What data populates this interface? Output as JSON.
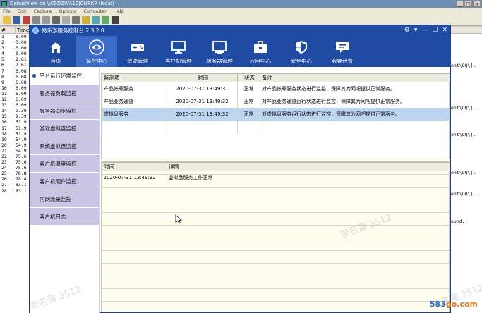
{
  "debugview": {
    "title": "DebugView on \\\\CSDZWA1CJCNRKP (local)",
    "menu": [
      "File",
      "Edit",
      "Capture",
      "Options",
      "Computer",
      "Help"
    ],
    "columns": [
      "#",
      "Time"
    ],
    "rows": [
      {
        "n": "1",
        "t": "0.00"
      },
      {
        "n": "2",
        "t": "0.00"
      },
      {
        "n": "3",
        "t": "0.00"
      },
      {
        "n": "4",
        "t": "0.00"
      },
      {
        "n": "5",
        "t": "2.61"
      },
      {
        "n": "6",
        "t": "2.61"
      },
      {
        "n": "7",
        "t": "6.08"
      },
      {
        "n": "8",
        "t": "6.08"
      },
      {
        "n": "9",
        "t": "6.08"
      },
      {
        "n": "10",
        "t": "6.09"
      },
      {
        "n": "11",
        "t": "6.09"
      },
      {
        "n": "12",
        "t": "6.09"
      },
      {
        "n": "13",
        "t": "6.09"
      },
      {
        "n": "14",
        "t": "9.30"
      },
      {
        "n": "15",
        "t": "9.39"
      },
      {
        "n": "16",
        "t": "51.9"
      },
      {
        "n": "17",
        "t": "51.9"
      },
      {
        "n": "18",
        "t": "51.9"
      },
      {
        "n": "19",
        "t": "54.9"
      },
      {
        "n": "20",
        "t": "54.9"
      },
      {
        "n": "21",
        "t": "54.9"
      },
      {
        "n": "22",
        "t": "75.6"
      },
      {
        "n": "23",
        "t": "75.6"
      },
      {
        "n": "24",
        "t": "75.6"
      },
      {
        "n": "25",
        "t": "78.8"
      },
      {
        "n": "26",
        "t": "78.8"
      },
      {
        "n": "27",
        "t": "83.1"
      },
      {
        "n": "28",
        "t": "83.1"
      }
    ],
    "right_fragments": [
      {
        "text": "ent\\QQ\\]."
      },
      {
        "text": "ent\\QQ\\]."
      },
      {
        "text": "ent\\QQ\\]."
      },
      {
        "text": "ent\\QQ\\]."
      },
      {
        "text": "ent\\QQ\\]."
      },
      {
        "text": "ound."
      }
    ]
  },
  "app": {
    "title": "易乐游服务控制台 2.3.2.0",
    "nav": [
      {
        "label": "首页",
        "icon": "home-icon"
      },
      {
        "label": "监控中心",
        "icon": "eye-icon",
        "active": true
      },
      {
        "label": "资源管理",
        "icon": "gamepad-icon"
      },
      {
        "label": "客户机管理",
        "icon": "monitor-icon"
      },
      {
        "label": "服务器管理",
        "icon": "server-icon"
      },
      {
        "label": "应用中心",
        "icon": "toolbox-icon"
      },
      {
        "label": "安全中心",
        "icon": "shield-icon"
      },
      {
        "label": "我要计费",
        "icon": "chat-icon"
      }
    ],
    "sidebar": [
      {
        "label": "平台运行环境监控",
        "active": true
      },
      {
        "label": "服务器负载监控"
      },
      {
        "label": "服务器同步监控"
      },
      {
        "label": "游戏虚拟盘监控"
      },
      {
        "label": "系统虚拟盘监控"
      },
      {
        "label": "客户机温度监控"
      },
      {
        "label": "客户机硬件监控"
      },
      {
        "label": "内网流量监控"
      },
      {
        "label": "客户机日志"
      }
    ],
    "monitor_table": {
      "columns": [
        "监测项",
        "时间",
        "状态",
        "备注"
      ],
      "rows": [
        {
          "item": "产品帐号服务",
          "time": "2020-07-31 13:49:31",
          "status": "正常",
          "note": "对产品帐号服务状态进行监控，保障其为网吧提供正常服务。"
        },
        {
          "item": "产品业务通道",
          "time": "2020-07-31 13:49:32",
          "status": "正常",
          "note": "对产品业务通道运行状态进行监控，保障其为网吧提供正常服务。"
        },
        {
          "item": "虚拟盘服务",
          "time": "2020-07-31 13:49:32",
          "status": "正常",
          "note": "对虚拟盘服务运行状态进行监控，保障其为网吧提供正常服务。",
          "selected": true
        }
      ]
    },
    "detail_table": {
      "columns": [
        "时间",
        "详情"
      ],
      "rows": [
        {
          "time": "2020-07-31 13:49:32",
          "detail": "虚拟盘服务工作正常"
        }
      ]
    }
  },
  "watermark_text": "李名蒲 3512",
  "site_logo": {
    "prefix": "583",
    "suffix": "go.com"
  },
  "colors": {
    "nav_bg": "#1f4ba3",
    "nav_active": "#3a6cc8",
    "sidebar_item": "#c9c5e4",
    "selected_row": "#bcd6f2",
    "logo_orange": "#e07a10"
  }
}
